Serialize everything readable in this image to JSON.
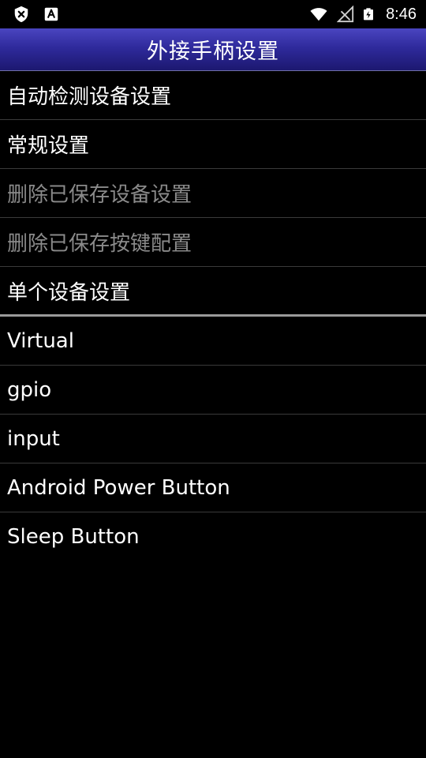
{
  "status_bar": {
    "time": "8:46",
    "icons_left": [
      "shield-x-icon",
      "a-notification-icon"
    ],
    "icons_right": [
      "wifi-icon",
      "no-signal-icon",
      "battery-charging-icon"
    ]
  },
  "header": {
    "title": "外接手柄设置",
    "gradient_colors": [
      "#4a45c0",
      "#1c1870"
    ]
  },
  "settings": {
    "auto_detect": "自动检测设备设置",
    "general": "常规设置",
    "delete_saved_device": "删除已保存设备设置",
    "delete_saved_keys": "删除已保存按键配置",
    "single_device": "单个设备设置"
  },
  "devices": [
    "Virtual",
    "gpio",
    "input",
    "Android Power Button",
    "Sleep Button"
  ]
}
